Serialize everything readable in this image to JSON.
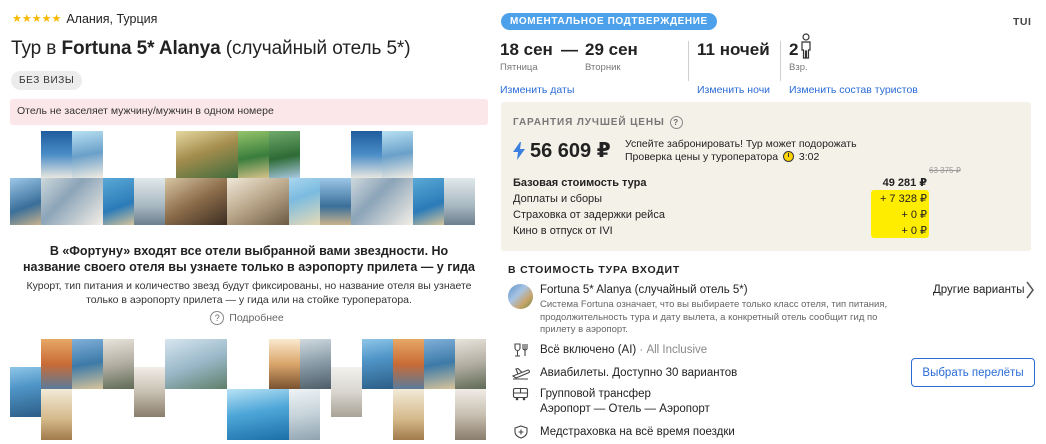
{
  "header": {
    "stars": "★★★★★",
    "location": "Алания, Турция",
    "title_prefix": "Тур в ",
    "title_bold": "Fortuna 5* Alanya",
    "title_suffix": " (случайный отель 5*)",
    "visa_badge": "БЕЗ ВИЗЫ",
    "warning": "Отель не заселяет мужчину/мужчин в одном номере"
  },
  "fortune": {
    "heading": "В «Фортуну» входят все отели выбранной вами звездности. Но название своего отеля вы узнаете только в аэропорту прилета — у гида",
    "description": "Курорт, тип питания и количество звезд будут фиксированы, но название отеля вы узнаете только в аэропорту прилета — у гида или на стойке туроператора.",
    "more_label": "Подробнее",
    "help_icon": "?"
  },
  "booking": {
    "confirm_badge": "МОМЕНТАЛЬНОЕ ПОДТВЕРЖДЕНИЕ",
    "operator": "TUI",
    "date_from": "18 сен",
    "date_dash": "—",
    "date_to": "29 сен",
    "day_from": "Пятница",
    "day_to": "Вторник",
    "nights": "11 ночей",
    "tourists_count": "2",
    "tourists_label": "Взр.",
    "change_dates": "Изменить даты",
    "change_nights": "Изменить ночи",
    "change_tourists": "Изменить состав туристов"
  },
  "price": {
    "guarantee_label": "ГАРАНТИЯ ЛУЧШЕЙ ЦЕНЫ",
    "help_icon": "?",
    "total": "56 609 ₽",
    "note_line1": "Успейте забронировать! Тур может подорожать",
    "note_line2": "Проверка цены у туроператора",
    "timer": "3:02",
    "old_price": "63 375 ₽",
    "rows": [
      {
        "label": "Базовая стоимость тура",
        "value": "49 281 ₽"
      },
      {
        "label": "Доплаты и сборы",
        "value": "+ 7 328 ₽"
      },
      {
        "label": "Страховка от задержки рейса",
        "value": "+ 0 ₽"
      },
      {
        "label": "Кино в отпуск от IVI",
        "value": "+ 0 ₽"
      }
    ]
  },
  "included": {
    "title": "В СТОИМОСТЬ ТУРА ВХОДИТ",
    "hotel_name": "Fortuna 5* Alanya (случайный отель 5*)",
    "hotel_desc": "Система Fortuna означает, что вы выбираете только класс отеля, тип питания, продолжительность тура и дату вылета, а конкретный отель сообщит гид по прилету в аэропорт.",
    "other_options": "Другие варианты",
    "meal": "Всё включено (AI)",
    "meal_sub": " · All Inclusive",
    "flights": "Авиабилеты. Доступно 30 вариантов",
    "choose_flights": "Выбрать перелёты",
    "transfer_line1": "Групповой трансфер",
    "transfer_line2": "Аэропорт — Отель — Аэропорт",
    "insurance": "Медстраховка на всё время поездки"
  },
  "colors": {
    "accent_blue": "#2a6bd6",
    "badge_blue": "#4da0ea",
    "star_yellow": "#f6b800",
    "highlight_yellow": "#ffed00",
    "price_bg": "#f4f1e8",
    "warning_bg": "#fbe7ea"
  }
}
